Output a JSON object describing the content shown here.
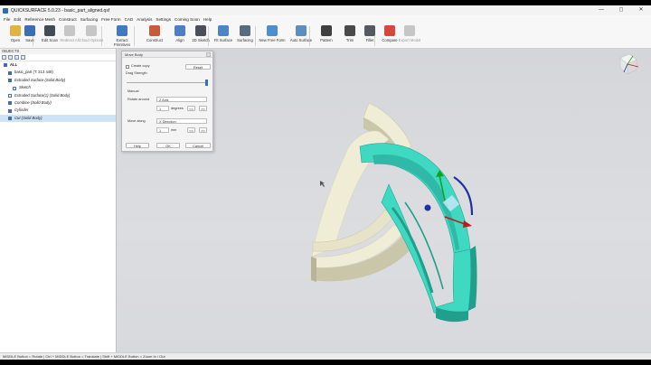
{
  "window": {
    "title": "QUICKSURFACE 5.0.23 - basic_part_aligned.qsf",
    "controls": [
      "—",
      "◻",
      "✕"
    ]
  },
  "menu": [
    "File",
    "Edit",
    "Reference Mesh",
    "Construct",
    "Surfacing",
    "Free Form",
    "CAD",
    "Analysis",
    "Settings",
    "Coming Soon",
    "Help"
  ],
  "toolbar": [
    {
      "label": "Open",
      "icon": "folder-open-icon",
      "color": "#e3b341",
      "enabled": true
    },
    {
      "label": "Save",
      "icon": "save-icon",
      "color": "#3a6fb8",
      "enabled": true
    },
    {
      "label": "Edit Scan",
      "icon": "edit-scan-icon",
      "color": "#444b55",
      "enabled": true
    },
    {
      "label": "Redeact All",
      "icon": "redeact-icon",
      "color": "#8a8a8a",
      "enabled": false
    },
    {
      "label": "Cloud Options",
      "icon": "cloud-icon",
      "color": "#8a8a8a",
      "enabled": false
    },
    {
      "label": "Extract Primitives",
      "icon": "primitives-icon",
      "color": "#3d7ac0",
      "enabled": true
    },
    {
      "label": "Construct",
      "icon": "construct-icon",
      "color": "#c85a3a",
      "enabled": true
    },
    {
      "label": "Align",
      "icon": "align-icon",
      "color": "#4d7fc4",
      "enabled": true
    },
    {
      "label": "2D Sketch",
      "icon": "sketch-icon",
      "color": "#4a4f59",
      "enabled": true
    },
    {
      "label": "Fit Surface",
      "icon": "fit-surface-icon",
      "color": "#4a86c7",
      "enabled": true
    },
    {
      "label": "Surfacing",
      "icon": "surfacing-icon",
      "color": "#5a6b7d",
      "enabled": true
    },
    {
      "label": "New Free Form",
      "icon": "free-form-icon",
      "color": "#4b8fd0",
      "enabled": true
    },
    {
      "label": "Auto Surface",
      "icon": "auto-surface-icon",
      "color": "#5a8fc0",
      "enabled": true
    },
    {
      "label": "Pattern",
      "icon": "pattern-icon",
      "color": "#3f3f3f",
      "enabled": true
    },
    {
      "label": "Trim",
      "icon": "trim-icon",
      "color": "#4a4a4a",
      "enabled": true
    },
    {
      "label": "Fillet",
      "icon": "fillet-icon",
      "color": "#555a61",
      "enabled": true
    },
    {
      "label": "Compare",
      "icon": "compare-icon",
      "color": "#d8473a",
      "enabled": true
    },
    {
      "label": "Export Model",
      "icon": "export-icon",
      "color": "#8a8a8a",
      "enabled": false
    }
  ],
  "objects": {
    "header": "OBJECTS",
    "items": [
      {
        "label": "ALL",
        "level": 0,
        "checked": true,
        "bold": true,
        "italic": false,
        "selected": false
      },
      {
        "label": "basic_part (T: 213 448)",
        "level": 1,
        "checked": true,
        "bold": false,
        "italic": false,
        "selected": false
      },
      {
        "label": "Extruded Surface (Solid Body)",
        "level": 1,
        "checked": true,
        "bold": false,
        "italic": true,
        "selected": false
      },
      {
        "label": "Sketch",
        "level": 2,
        "checked": false,
        "bold": false,
        "italic": true,
        "selected": false
      },
      {
        "label": "Extruded Surface(1) (Solid Body)",
        "level": 1,
        "checked": false,
        "bold": false,
        "italic": true,
        "selected": false
      },
      {
        "label": "Combine (Solid Body)",
        "level": 1,
        "checked": true,
        "bold": false,
        "italic": true,
        "selected": false
      },
      {
        "label": "Cylinder",
        "level": 1,
        "checked": true,
        "bold": false,
        "italic": true,
        "selected": false
      },
      {
        "label": "Cut (Solid Body)",
        "level": 1,
        "checked": true,
        "bold": false,
        "italic": true,
        "selected": true
      }
    ]
  },
  "dialog": {
    "title": "Move Body",
    "create_copy": "Create copy",
    "reset": "Reset",
    "drag_strength": "Drag Strength",
    "manual": "Manual",
    "rotate_around": "Rotate around",
    "rotate_axis": "Z Axis",
    "rotate_value": "1",
    "rotate_unit": "degrees",
    "move_along": "Move along",
    "move_dir": "X Direction",
    "move_value": "1",
    "move_unit": "mm",
    "dec": "<<",
    "inc": ">>",
    "help": "Help",
    "ok": "OK",
    "cancel": "Cancel"
  },
  "status": "MIDDLE Button = Rotate | Ctrl + MIDDLE Button = Translate | Shift + MIDDLE Button = Zoom In / Out",
  "colors": {
    "teal": "#3fd9c2",
    "teal_dark": "#1f9f8c",
    "cream": "#efedd5",
    "cream_dark": "#c9c6a9",
    "blue": "#1e2fa8",
    "green": "#12a31e",
    "red": "#b81d1d"
  }
}
